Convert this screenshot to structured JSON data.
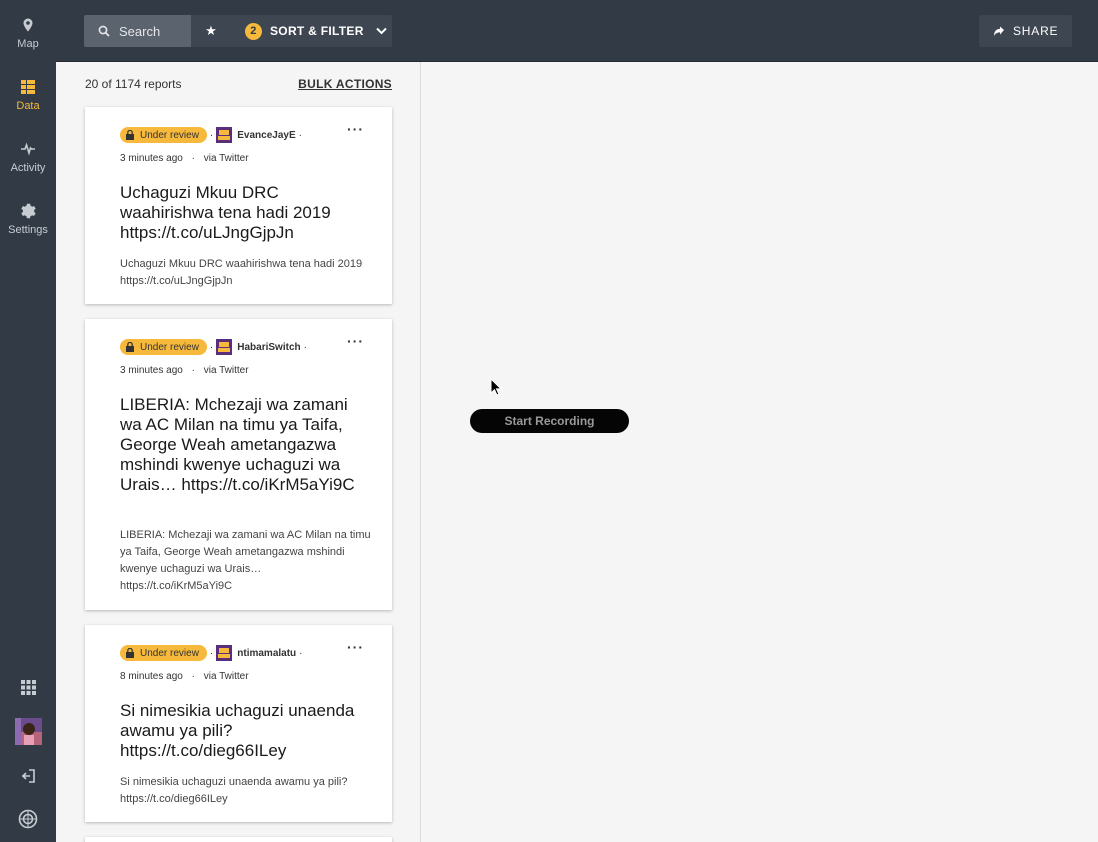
{
  "nav": {
    "items": [
      {
        "label": "Map",
        "icon": "map-pin-icon"
      },
      {
        "label": "Data",
        "icon": "data-icon"
      },
      {
        "label": "Activity",
        "icon": "activity-icon"
      },
      {
        "label": "Settings",
        "icon": "gear-icon"
      }
    ],
    "bottom_icons": [
      "apps-grid-icon",
      "user-avatar",
      "logout-icon",
      "ushahidi-logo"
    ]
  },
  "toolbar": {
    "search_label": "Search",
    "filter_count": "2",
    "filter_label": "SORT & FILTER",
    "share_label": "SHARE"
  },
  "list": {
    "count_label": "20 of 1174 reports",
    "bulk_actions_label": "BULK ACTIONS",
    "posts": [
      {
        "status": "Under review",
        "author": "EvanceJayE",
        "time": "3 minutes ago",
        "source": "via Twitter",
        "title": "Uchaguzi Mkuu DRC waahirishwa tena hadi 2019 https://t.co/uLJngGjpJn",
        "description": "Uchaguzi Mkuu DRC waahirishwa tena hadi 2019 https://t.co/uLJngGjpJn"
      },
      {
        "status": "Under review",
        "author": "HabariSwitch",
        "time": "3 minutes ago",
        "source": "via Twitter",
        "title": "LIBERIA: Mchezaji wa zamani wa AC Milan na timu ya Taifa, George Weah ametangazwa mshindi kwenye uchaguzi wa Urais… https://t.co/iKrM5aYi9C",
        "description": "LIBERIA: Mchezaji wa zamani wa AC Milan na timu ya Taifa, George Weah ametangazwa mshindi kwenye uchaguzi wa Urais… https://t.co/iKrM5aYi9C"
      },
      {
        "status": "Under review",
        "author": "ntimamalatu",
        "time": "8 minutes ago",
        "source": "via Twitter",
        "title": "Si nimesikia uchaguzi unaenda awamu ya pili? https://t.co/dieg66ILey",
        "description": "Si nimesikia uchaguzi unaenda awamu ya pili? https://t.co/dieg66ILey"
      }
    ]
  },
  "overlay": {
    "record_label": "Start Recording"
  },
  "colors": {
    "sidebar_bg": "#323a45",
    "accent": "#f6b93b",
    "page_bg": "#f5f5f5"
  }
}
